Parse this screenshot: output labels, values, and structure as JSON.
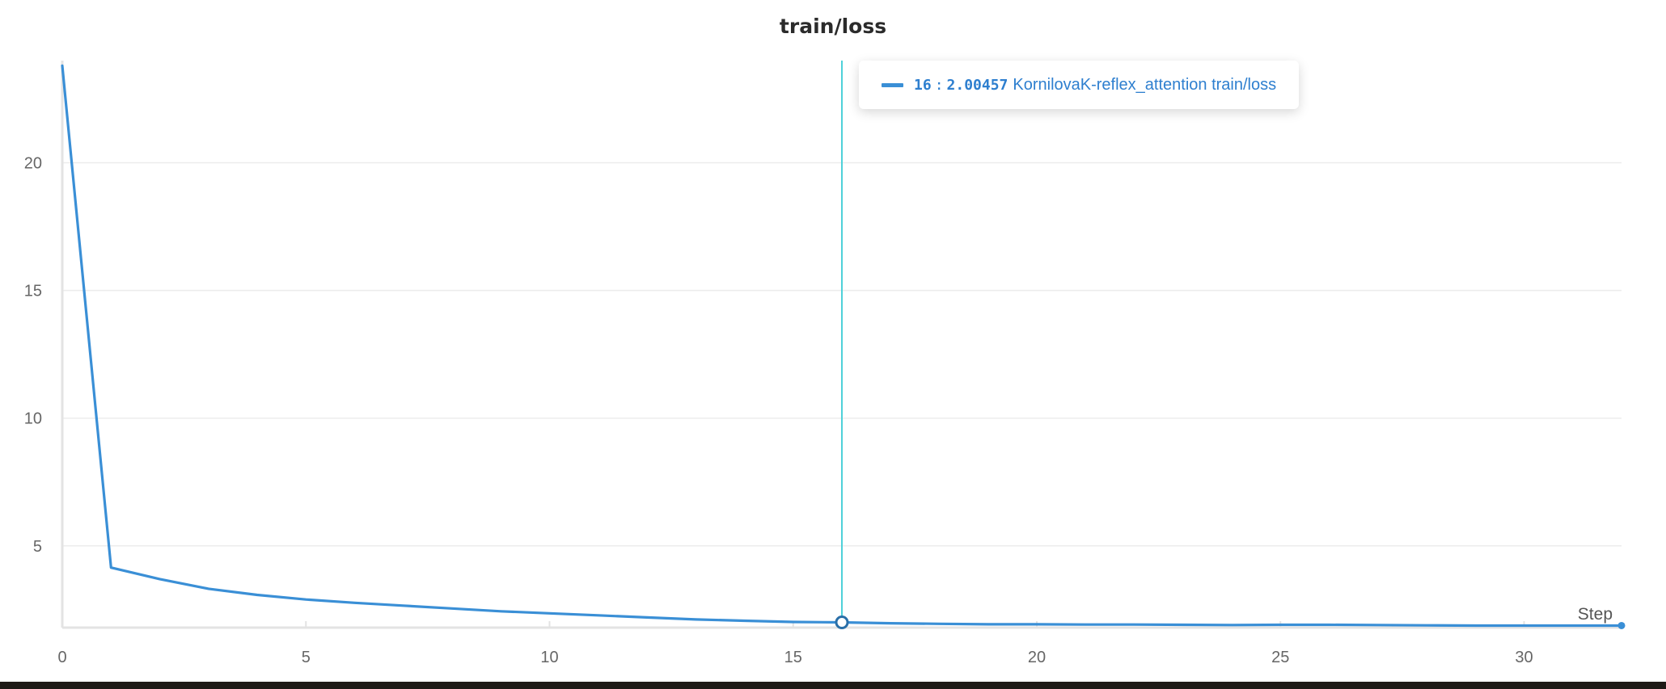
{
  "colors": {
    "series": "#3a8fd6",
    "crosshair": "#4fd1d9",
    "grid": "#ececec",
    "axis": "#e3e3e3",
    "tick_text": "#666666"
  },
  "tooltip": {
    "step": "16",
    "separator": ":",
    "value": "2.00457",
    "series_name": "KornilovaK-reflex_attention train/loss"
  },
  "chart_data": {
    "type": "line",
    "title": "train/loss",
    "xlabel": "Step",
    "ylabel": "",
    "xlim": [
      0,
      32
    ],
    "ylim": [
      1.8,
      24
    ],
    "xticks": [
      0,
      5,
      10,
      15,
      20,
      25,
      30
    ],
    "yticks": [
      5,
      10,
      15,
      20
    ],
    "grid": true,
    "hover_step": 16,
    "series": [
      {
        "name": "KornilovaK-reflex_attention train/loss",
        "x": [
          0,
          1,
          2,
          3,
          4,
          5,
          6,
          7,
          8,
          9,
          10,
          11,
          12,
          13,
          14,
          15,
          16,
          17,
          18,
          19,
          20,
          21,
          22,
          23,
          24,
          25,
          26,
          27,
          28,
          29,
          30,
          31,
          32
        ],
        "y": [
          23.8,
          4.15,
          3.7,
          3.32,
          3.08,
          2.9,
          2.77,
          2.66,
          2.55,
          2.44,
          2.36,
          2.28,
          2.2,
          2.12,
          2.07,
          2.02,
          2.00457,
          1.97,
          1.95,
          1.93,
          1.93,
          1.92,
          1.92,
          1.91,
          1.9,
          1.91,
          1.91,
          1.9,
          1.89,
          1.88,
          1.88,
          1.88,
          1.88
        ]
      }
    ]
  }
}
